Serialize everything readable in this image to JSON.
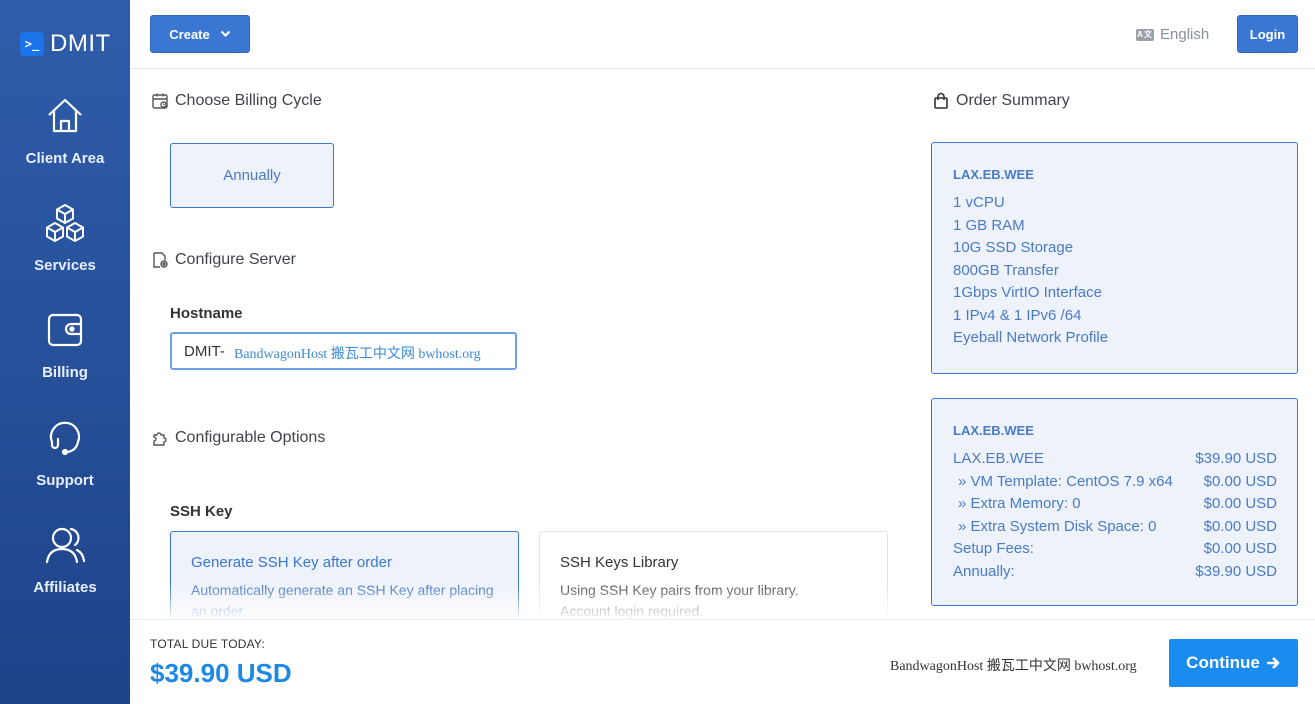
{
  "sidebar": {
    "brand": "DMIT",
    "brand_mark": "&gt;_",
    "items": [
      {
        "label": "Client Area",
        "icon": "home-icon"
      },
      {
        "label": "Services",
        "icon": "cubes-icon"
      },
      {
        "label": "Billing",
        "icon": "wallet-icon"
      },
      {
        "label": "Support",
        "icon": "headset-icon"
      },
      {
        "label": "Affiliates",
        "icon": "users-icon"
      }
    ]
  },
  "topbar": {
    "create_label": "Create",
    "language_label": "English",
    "language_icon": "translate-icon",
    "login_label": "Login"
  },
  "billing": {
    "title": "Choose Billing Cycle",
    "option": "Annually"
  },
  "configure": {
    "title": "Configure Server",
    "hostname_label": "Hostname",
    "hostname_value": "DMIT-"
  },
  "watermark": "BandwagonHost 搬瓦工中文网 bwhost.org",
  "options": {
    "title": "Configurable Options",
    "ssh_label": "SSH Key",
    "cards": [
      {
        "title": "Generate SSH Key after order",
        "desc_1": "Automatically generate an SSH Key after placing",
        "desc_2": "an order."
      },
      {
        "title": "SSH Keys Library",
        "desc_1": "Using SSH Key pairs from your library.",
        "desc_2": "Account login required."
      }
    ]
  },
  "summary": {
    "title": "Order Summary",
    "plan": "LAX.EB.WEE",
    "specs": [
      "1 vCPU",
      "1 GB RAM",
      "10G SSD Storage",
      "800GB Transfer",
      "1Gbps VirtIO Interface",
      "1 IPv4 & 1 IPv6 /64",
      "Eyeball Network Profile"
    ],
    "price_head": "LAX.EB.WEE",
    "lines": [
      {
        "label": "LAX.EB.WEE",
        "value": "$39.90 USD"
      },
      {
        "label": "» VM Template: CentOS 7.9 x64",
        "value": "$0.00 USD"
      },
      {
        "label": "» Extra Memory: 0",
        "value": "$0.00 USD"
      },
      {
        "label": "» Extra System Disk Space: 0",
        "value": "$0.00 USD"
      },
      {
        "label": "Setup Fees:",
        "value": "$0.00 USD"
      },
      {
        "label": "Annually:",
        "value": "$39.90 USD"
      }
    ]
  },
  "footer": {
    "due_label": "TOTAL DUE TODAY:",
    "due_amount": "$39.90 USD",
    "continue_label": "Continue"
  },
  "colors": {
    "sidebar": "#2a56a3",
    "primary": "#3a77d3",
    "continue": "#1a8cf0",
    "accent_text": "#4a7bc7",
    "card_bg": "#eef2fa"
  }
}
